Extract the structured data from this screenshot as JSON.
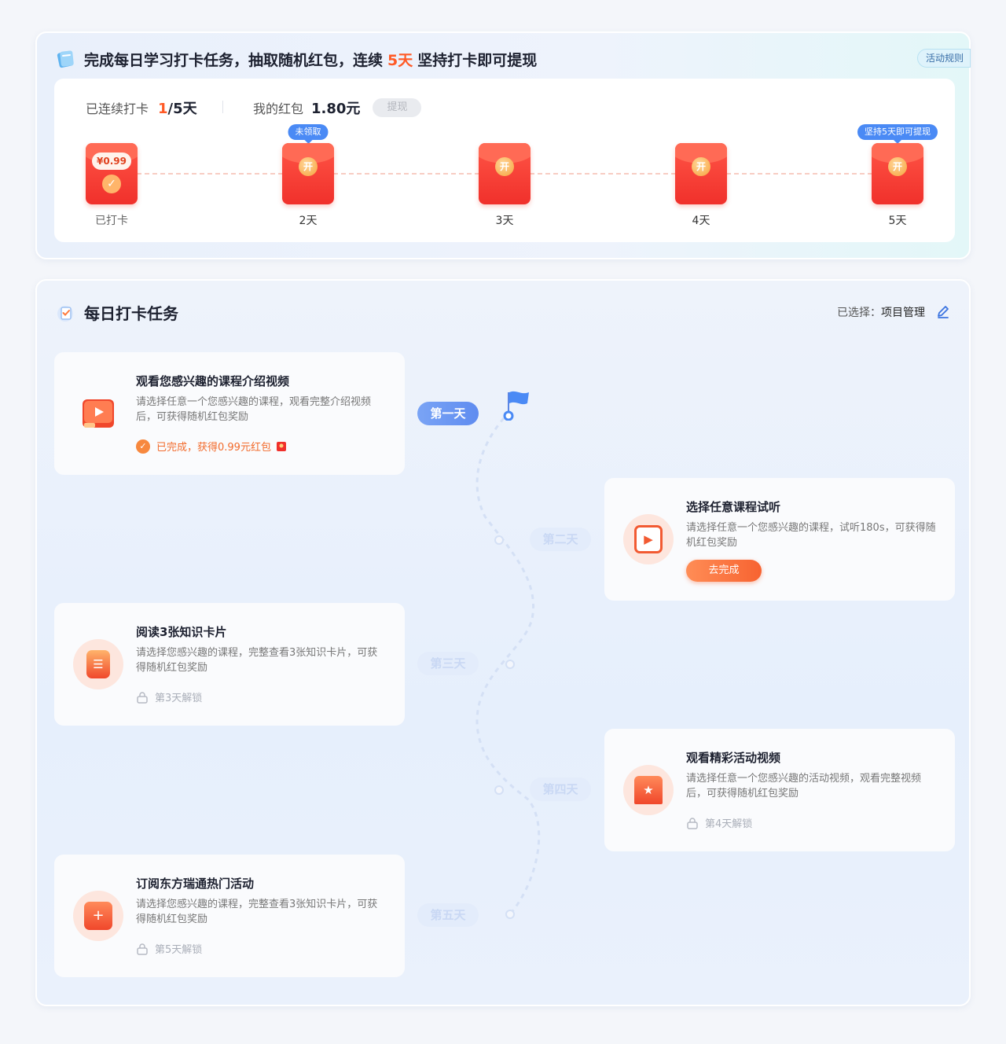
{
  "top": {
    "title_before": "完成每日学习打卡任务，抽取随机红包，连续",
    "title_days": "5天",
    "title_middle": "坚持打卡即",
    "title_underlined": "可提现",
    "rules_button": "活动规则",
    "streak_label": "已连续打卡",
    "streak_current": "1",
    "streak_total": "/5天",
    "wallet_label": "我的红包",
    "wallet_amount": "1.80元",
    "withdraw_button": "提现",
    "envelopes": [
      {
        "label": "已打卡",
        "amount": "¥0.99",
        "check": "✓",
        "state": "done"
      },
      {
        "label": "2天",
        "badge": "未领取",
        "coin": "开"
      },
      {
        "label": "3天",
        "coin": "开"
      },
      {
        "label": "4天",
        "coin": "开"
      },
      {
        "label": "5天",
        "badge": "坚持5天即可提现",
        "coin": "开"
      }
    ]
  },
  "bottom": {
    "title": "每日打卡任务",
    "selected_label": "已选择：",
    "selected_value": "项目管理",
    "days": [
      "第一天",
      "第二天",
      "第三天",
      "第四天",
      "第五天"
    ],
    "tasks": [
      {
        "title": "观看您感兴趣的课程介绍视频",
        "desc": "请选择任意一个您感兴趣的课程，观看完整介绍视频后，可获得随机红包奖励",
        "status": "已完成，获得0.99元红包",
        "icon": "video-book-icon"
      },
      {
        "title": "选择任意课程试听",
        "desc": "请选择任意一个您感兴趣的课程，试听180s，可获得随机红包奖励",
        "button": "去完成",
        "icon": "play-icon"
      },
      {
        "title": "阅读3张知识卡片",
        "desc": "请选择您感兴趣的课程，完整查看3张知识卡片，可获得随机红包奖励",
        "status": "第3天解锁",
        "icon": "card-icon"
      },
      {
        "title": "观看精彩活动视频",
        "desc": "请选择任意一个您感兴趣的活动视频，观看完整视频后，可获得随机红包奖励",
        "status": "第4天解锁",
        "icon": "star-screen-icon"
      },
      {
        "title": "订阅东方瑞通热门活动",
        "desc": "请选择您感兴趣的课程，完整查看3张知识卡片，可获得随机红包奖励",
        "status": "第5天解锁",
        "icon": "gift-icon"
      }
    ]
  },
  "colors": {
    "accent": "#ff5a26",
    "blue": "#4a8af5",
    "red": "#f0302b"
  }
}
